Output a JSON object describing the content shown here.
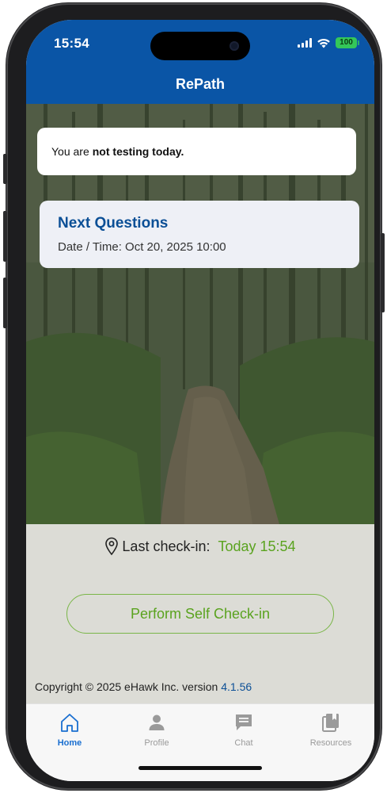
{
  "status_bar": {
    "time": "15:54",
    "battery": "100"
  },
  "header": {
    "title": "RePath"
  },
  "testing_card": {
    "prefix": "You are",
    "status": "not testing today."
  },
  "questions_card": {
    "title": "Next Questions",
    "datetime": "Date / Time: Oct 20, 2025 10:00"
  },
  "checkin": {
    "label": "Last check-in:",
    "value": "Today 15:54",
    "button_label": "Perform Self Check-in"
  },
  "footer": {
    "copyright": "Copyright © 2025 eHawk Inc. version",
    "version": "4.1.56"
  },
  "tabs": [
    {
      "label": "Home",
      "icon": "home-icon",
      "active": true
    },
    {
      "label": "Profile",
      "icon": "person-icon",
      "active": false
    },
    {
      "label": "Chat",
      "icon": "chat-icon",
      "active": false
    },
    {
      "label": "Resources",
      "icon": "book-icon",
      "active": false
    }
  ],
  "colors": {
    "header_blue": "#0a55a6",
    "accent_green": "#5aa31f",
    "title_blue": "#0b4f96",
    "tab_active": "#1a6fd0"
  }
}
